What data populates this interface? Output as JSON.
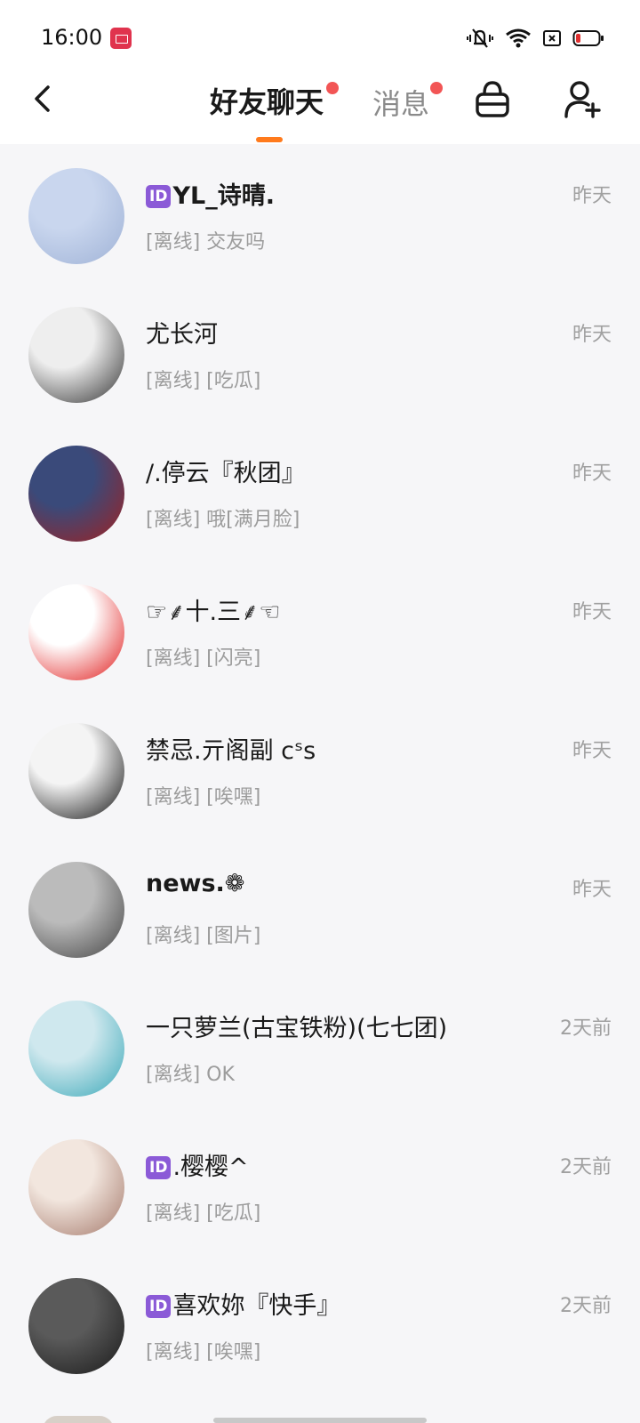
{
  "status_bar": {
    "time": "16:00"
  },
  "nav": {
    "tab_friends": "好友聊天",
    "tab_messages": "消息"
  },
  "chats": [
    {
      "badge": "ID",
      "name": "YL_诗晴.",
      "time": "昨天",
      "status": "[离线]",
      "message": "交友吗",
      "bold": true,
      "avatar_colors": [
        "#c9d6ee",
        "#9fb2d6"
      ]
    },
    {
      "badge": "",
      "name": "尤长河",
      "time": "昨天",
      "status": "[离线]",
      "message": "[吃瓜]",
      "bold": false,
      "avatar_colors": [
        "#eeeeee",
        "#333333"
      ]
    },
    {
      "badge": "",
      "name": "/.停云『秋团』",
      "time": "昨天",
      "status": "[离线]",
      "message": "哦[满月脸]",
      "bold": false,
      "avatar_colors": [
        "#3a4a7a",
        "#a02020"
      ]
    },
    {
      "badge": "",
      "name": "☞⸙十.三⸙☜",
      "time": "昨天",
      "status": "[离线]",
      "message": "[闪亮]",
      "bold": false,
      "avatar_colors": [
        "#ffffff",
        "#e01818"
      ]
    },
    {
      "badge": "",
      "name": "禁忌.亓阁副 ᴄˢs",
      "time": "昨天",
      "status": "[离线]",
      "message": "[唉嘿]",
      "bold": false,
      "avatar_colors": [
        "#f4f4f4",
        "#111111"
      ]
    },
    {
      "badge": "",
      "name": "news.❁",
      "time": "昨天",
      "status": "[离线]",
      "message": "[图片]",
      "bold": true,
      "avatar_colors": [
        "#bbbbbb",
        "#444444"
      ]
    },
    {
      "badge": "",
      "name": "一只萝兰(古宝铁粉)(七七团)",
      "time": "2天前",
      "status": "[离线]",
      "message": "OK",
      "bold": false,
      "avatar_colors": [
        "#cfe8ee",
        "#3aa8b8"
      ]
    },
    {
      "badge": "ID",
      "name": ".樱樱^",
      "time": "2天前",
      "status": "[离线]",
      "message": "[吃瓜]",
      "bold": false,
      "avatar_colors": [
        "#f2e6de",
        "#a4786a"
      ]
    },
    {
      "badge": "ID",
      "name": "喜欢妳『快手』",
      "time": "2天前",
      "status": "[离线]",
      "message": "[唉嘿]",
      "bold": false,
      "avatar_colors": [
        "#5a5a5a",
        "#1a1a1a"
      ]
    }
  ],
  "colors": {
    "accent": "#ff7a1c",
    "badge_dot": "#f25555",
    "id_badge": "#8b5ad7"
  }
}
